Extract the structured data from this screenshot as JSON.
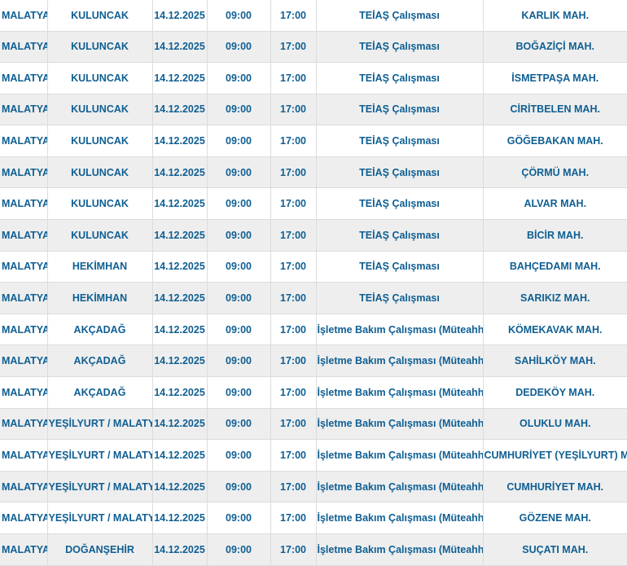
{
  "rows": [
    [
      "MALATYA",
      "KULUNCAK",
      "14.12.2025",
      "09:00",
      "17:00",
      "TEİAŞ Çalışması",
      "KARLIK MAH."
    ],
    [
      "MALATYA",
      "KULUNCAK",
      "14.12.2025",
      "09:00",
      "17:00",
      "TEİAŞ Çalışması",
      "BOĞAZİÇİ MAH."
    ],
    [
      "MALATYA",
      "KULUNCAK",
      "14.12.2025",
      "09:00",
      "17:00",
      "TEİAŞ Çalışması",
      "İSMETPAŞA MAH."
    ],
    [
      "MALATYA",
      "KULUNCAK",
      "14.12.2025",
      "09:00",
      "17:00",
      "TEİAŞ Çalışması",
      "CİRİTBELEN MAH."
    ],
    [
      "MALATYA",
      "KULUNCAK",
      "14.12.2025",
      "09:00",
      "17:00",
      "TEİAŞ Çalışması",
      "GÖĞEBAKAN MAH."
    ],
    [
      "MALATYA",
      "KULUNCAK",
      "14.12.2025",
      "09:00",
      "17:00",
      "TEİAŞ Çalışması",
      "ÇÖRMÜ MAH."
    ],
    [
      "MALATYA",
      "KULUNCAK",
      "14.12.2025",
      "09:00",
      "17:00",
      "TEİAŞ Çalışması",
      "ALVAR MAH."
    ],
    [
      "MALATYA",
      "KULUNCAK",
      "14.12.2025",
      "09:00",
      "17:00",
      "TEİAŞ Çalışması",
      "BİCİR MAH."
    ],
    [
      "MALATYA",
      "HEKİMHAN",
      "14.12.2025",
      "09:00",
      "17:00",
      "TEİAŞ Çalışması",
      "BAHÇEDAMI MAH."
    ],
    [
      "MALATYA",
      "HEKİMHAN",
      "14.12.2025",
      "09:00",
      "17:00",
      "TEİAŞ Çalışması",
      "SARIKIZ MAH."
    ],
    [
      "MALATYA",
      "AKÇADAĞ",
      "14.12.2025",
      "09:00",
      "17:00",
      "İşletme Bakım Çalışması (Müteahhit)",
      "KÖMEKAVAK MAH."
    ],
    [
      "MALATYA",
      "AKÇADAĞ",
      "14.12.2025",
      "09:00",
      "17:00",
      "İşletme Bakım Çalışması (Müteahhit)",
      "SAHİLKÖY MAH."
    ],
    [
      "MALATYA",
      "AKÇADAĞ",
      "14.12.2025",
      "09:00",
      "17:00",
      "İşletme Bakım Çalışması (Müteahhit)",
      "DEDEKÖY MAH."
    ],
    [
      "MALATYA",
      "YEŞİLYURT / MALATYA",
      "14.12.2025",
      "09:00",
      "17:00",
      "İşletme Bakım Çalışması (Müteahhit)",
      "OLUKLU MAH."
    ],
    [
      "MALATYA",
      "YEŞİLYURT / MALATYA",
      "14.12.2025",
      "09:00",
      "17:00",
      "İşletme Bakım Çalışması (Müteahhit)",
      "CUMHURİYET (YEŞİLYURT) MAH"
    ],
    [
      "MALATYA",
      "YEŞİLYURT / MALATYA",
      "14.12.2025",
      "09:00",
      "17:00",
      "İşletme Bakım Çalışması (Müteahhit)",
      "CUMHURİYET MAH."
    ],
    [
      "MALATYA",
      "YEŞİLYURT / MALATYA",
      "14.12.2025",
      "09:00",
      "17:00",
      "İşletme Bakım Çalışması (Müteahhit)",
      "GÖZENE MAH."
    ],
    [
      "MALATYA",
      "DOĞANŞEHİR",
      "14.12.2025",
      "09:00",
      "17:00",
      "İşletme Bakım Çalışması (Müteahhit)",
      "SUÇATI MAH."
    ]
  ]
}
